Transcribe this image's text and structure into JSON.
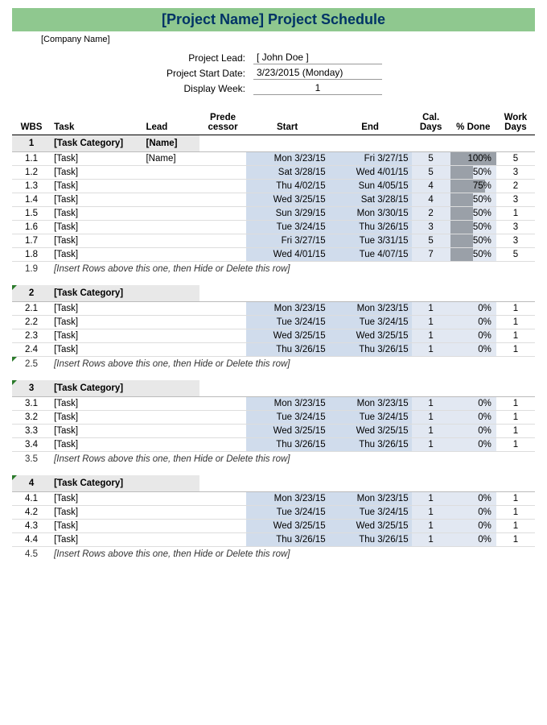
{
  "title": "[Project Name] Project Schedule",
  "company": "[Company Name]",
  "meta": {
    "project_lead_label": "Project Lead:",
    "project_lead_value": "[ John Doe ]",
    "start_date_label": "Project Start Date:",
    "start_date_value": "3/23/2015 (Monday)",
    "display_week_label": "Display Week:",
    "display_week_value": "1"
  },
  "headers": {
    "wbs": "WBS",
    "task": "Task",
    "lead": "Lead",
    "pred": "Prede cessor",
    "start": "Start",
    "end": "End",
    "cal": "Cal. Days",
    "done": "% Done",
    "work": "Work Days"
  },
  "insert_msg": "[Insert Rows above this one, then Hide or Delete this row]",
  "cat1": {
    "wbs": "1",
    "name": "[Task Category]",
    "lead": "[Name]",
    "rows": [
      {
        "wbs": "1.1",
        "task": "[Task]",
        "lead": "[Name]",
        "start": "Mon 3/23/15",
        "end": "Fri 3/27/15",
        "cal": "5",
        "done": "100%",
        "donepct": 100,
        "work": "5"
      },
      {
        "wbs": "1.2",
        "task": "[Task]",
        "lead": "",
        "start": "Sat 3/28/15",
        "end": "Wed 4/01/15",
        "cal": "5",
        "done": "50%",
        "donepct": 50,
        "work": "3"
      },
      {
        "wbs": "1.3",
        "task": "[Task]",
        "lead": "",
        "start": "Thu 4/02/15",
        "end": "Sun 4/05/15",
        "cal": "4",
        "done": "75%",
        "donepct": 75,
        "work": "2"
      },
      {
        "wbs": "1.4",
        "task": "[Task]",
        "lead": "",
        "start": "Wed 3/25/15",
        "end": "Sat 3/28/15",
        "cal": "4",
        "done": "50%",
        "donepct": 50,
        "work": "3"
      },
      {
        "wbs": "1.5",
        "task": "[Task]",
        "lead": "",
        "start": "Sun 3/29/15",
        "end": "Mon 3/30/15",
        "cal": "2",
        "done": "50%",
        "donepct": 50,
        "work": "1"
      },
      {
        "wbs": "1.6",
        "task": "[Task]",
        "lead": "",
        "start": "Tue 3/24/15",
        "end": "Thu 3/26/15",
        "cal": "3",
        "done": "50%",
        "donepct": 50,
        "work": "3"
      },
      {
        "wbs": "1.7",
        "task": "[Task]",
        "lead": "",
        "start": "Fri 3/27/15",
        "end": "Tue 3/31/15",
        "cal": "5",
        "done": "50%",
        "donepct": 50,
        "work": "3"
      },
      {
        "wbs": "1.8",
        "task": "[Task]",
        "lead": "",
        "start": "Wed 4/01/15",
        "end": "Tue 4/07/15",
        "cal": "7",
        "done": "50%",
        "donepct": 50,
        "work": "5"
      }
    ],
    "insert_wbs": "1.9"
  },
  "cat2": {
    "wbs": "2",
    "name": "[Task Category]",
    "rows": [
      {
        "wbs": "2.1",
        "task": "[Task]",
        "start": "Mon 3/23/15",
        "end": "Mon 3/23/15",
        "cal": "1",
        "done": "0%",
        "donepct": 0,
        "work": "1"
      },
      {
        "wbs": "2.2",
        "task": "[Task]",
        "start": "Tue 3/24/15",
        "end": "Tue 3/24/15",
        "cal": "1",
        "done": "0%",
        "donepct": 0,
        "work": "1"
      },
      {
        "wbs": "2.3",
        "task": "[Task]",
        "start": "Wed 3/25/15",
        "end": "Wed 3/25/15",
        "cal": "1",
        "done": "0%",
        "donepct": 0,
        "work": "1"
      },
      {
        "wbs": "2.4",
        "task": "[Task]",
        "start": "Thu 3/26/15",
        "end": "Thu 3/26/15",
        "cal": "1",
        "done": "0%",
        "donepct": 0,
        "work": "1"
      }
    ],
    "insert_wbs": "2.5"
  },
  "cat3": {
    "wbs": "3",
    "name": "[Task Category]",
    "rows": [
      {
        "wbs": "3.1",
        "task": "[Task]",
        "start": "Mon 3/23/15",
        "end": "Mon 3/23/15",
        "cal": "1",
        "done": "0%",
        "donepct": 0,
        "work": "1"
      },
      {
        "wbs": "3.2",
        "task": "[Task]",
        "start": "Tue 3/24/15",
        "end": "Tue 3/24/15",
        "cal": "1",
        "done": "0%",
        "donepct": 0,
        "work": "1"
      },
      {
        "wbs": "3.3",
        "task": "[Task]",
        "start": "Wed 3/25/15",
        "end": "Wed 3/25/15",
        "cal": "1",
        "done": "0%",
        "donepct": 0,
        "work": "1"
      },
      {
        "wbs": "3.4",
        "task": "[Task]",
        "start": "Thu 3/26/15",
        "end": "Thu 3/26/15",
        "cal": "1",
        "done": "0%",
        "donepct": 0,
        "work": "1"
      }
    ],
    "insert_wbs": "3.5"
  },
  "cat4": {
    "wbs": "4",
    "name": "[Task Category]",
    "rows": [
      {
        "wbs": "4.1",
        "task": "[Task]",
        "start": "Mon 3/23/15",
        "end": "Mon 3/23/15",
        "cal": "1",
        "done": "0%",
        "donepct": 0,
        "work": "1"
      },
      {
        "wbs": "4.2",
        "task": "[Task]",
        "start": "Tue 3/24/15",
        "end": "Tue 3/24/15",
        "cal": "1",
        "done": "0%",
        "donepct": 0,
        "work": "1"
      },
      {
        "wbs": "4.3",
        "task": "[Task]",
        "start": "Wed 3/25/15",
        "end": "Wed 3/25/15",
        "cal": "1",
        "done": "0%",
        "donepct": 0,
        "work": "1"
      },
      {
        "wbs": "4.4",
        "task": "[Task]",
        "start": "Thu 3/26/15",
        "end": "Thu 3/26/15",
        "cal": "1",
        "done": "0%",
        "donepct": 0,
        "work": "1"
      }
    ],
    "insert_wbs": "4.5"
  }
}
